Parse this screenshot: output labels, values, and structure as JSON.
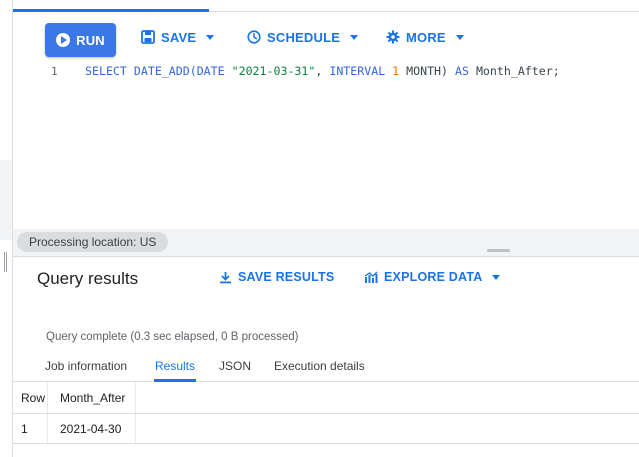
{
  "toolbar": {
    "run_label": "RUN",
    "save_label": "SAVE",
    "schedule_label": "SCHEDULE",
    "more_label": "MORE"
  },
  "editor": {
    "line_number": "1",
    "tokens": {
      "select": "SELECT ",
      "func": "DATE_ADD(",
      "date_kw": "DATE",
      "space1": " ",
      "date_str": "\"2021-03-31\"",
      "comma": ", ",
      "interval_kw": "INTERVAL",
      "space2": " ",
      "one": "1",
      "month": " MONTH) ",
      "as_kw": "AS",
      "alias": " Month_After;"
    }
  },
  "location": {
    "label": "Processing location: US"
  },
  "results": {
    "title": "Query results",
    "save_results_label": "SAVE RESULTS",
    "explore_data_label": "EXPLORE DATA",
    "status": "Query complete (0.3 sec elapsed, 0 B processed)",
    "tabs": [
      "Job information",
      "Results",
      "JSON",
      "Execution details"
    ],
    "active_tab": "Results",
    "columns": [
      "Row",
      "Month_After"
    ],
    "rows": [
      {
        "row": "1",
        "month_after": "2021-04-30"
      }
    ]
  },
  "colors": {
    "accent": "#1a73e8",
    "run_button": "#3b78e7",
    "keyword": "#3367d6",
    "string": "#0b8043",
    "number": "#e8710a"
  },
  "icons": [
    "play-circle-icon",
    "save-icon",
    "clock-icon",
    "gear-icon",
    "caret-down-icon",
    "download-icon",
    "chart-icon"
  ]
}
